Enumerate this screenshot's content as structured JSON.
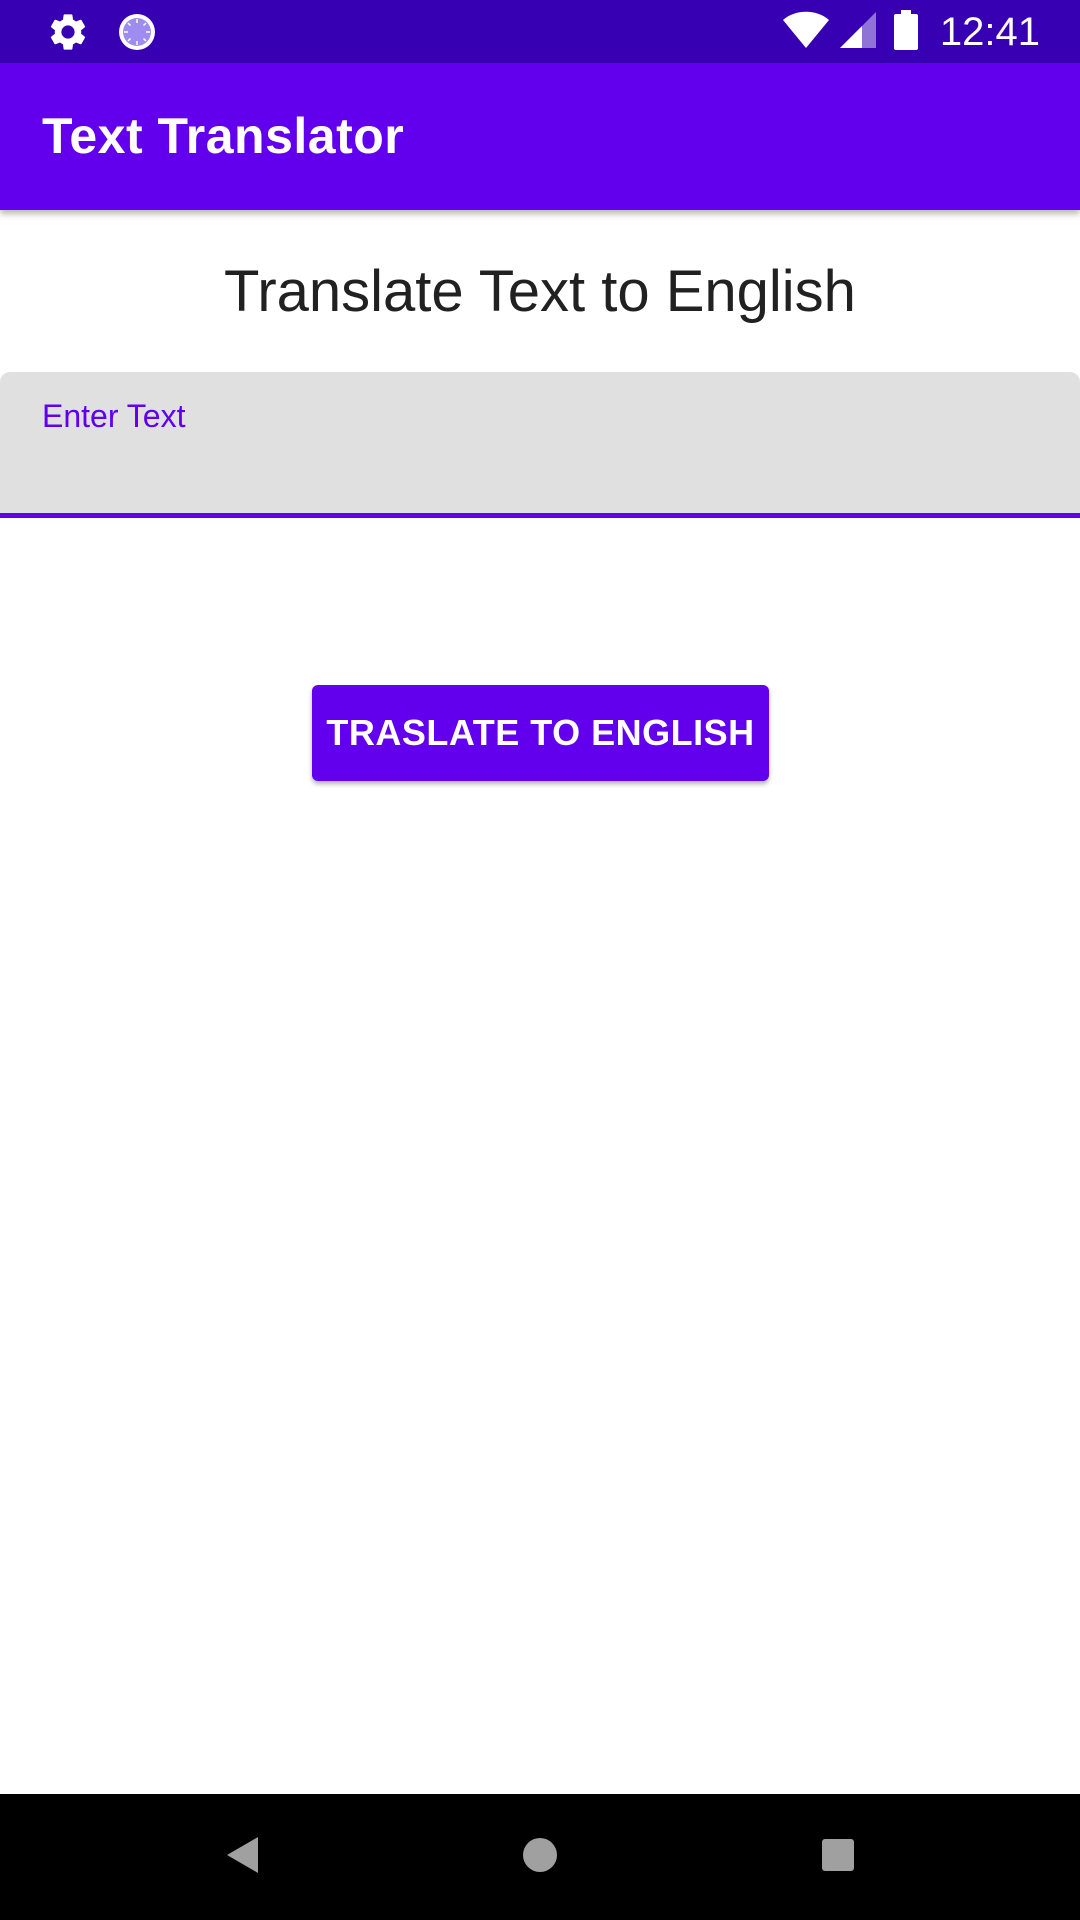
{
  "status_bar": {
    "time": "12:41",
    "left_icons": [
      "settings-icon",
      "sync-progress-icon"
    ],
    "right_icons": [
      "wifi-icon",
      "cellular-signal-icon",
      "battery-icon"
    ]
  },
  "app_bar": {
    "title": "Text Translator",
    "color": "#6200ee"
  },
  "main": {
    "heading": "Translate Text to English",
    "input": {
      "label": "Enter Text",
      "value": ""
    },
    "translate_button_label": "TRASLATE TO ENGLISH"
  },
  "nav_bar": {
    "icons": [
      "back-icon",
      "home-icon",
      "recents-icon"
    ]
  },
  "colors": {
    "status_bar": "#3700b3",
    "primary": "#6200ee",
    "input_background": "#e0e0e0",
    "text": "#212121"
  }
}
